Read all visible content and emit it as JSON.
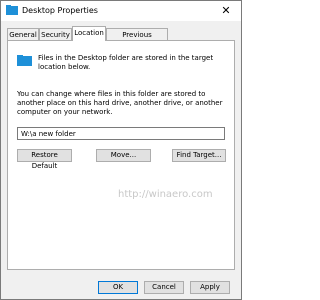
{
  "window": {
    "title": "Desktop Properties",
    "close_glyph": "✕",
    "icon": "folder-icon"
  },
  "tabs": [
    {
      "label": "General"
    },
    {
      "label": "Security"
    },
    {
      "label": "Location",
      "active": true
    },
    {
      "label": "Previous Versions"
    }
  ],
  "location": {
    "info_text": "Files in the Desktop folder are stored in the target location below.",
    "description": "You can change where files in this folder are stored to another place on this hard drive, another drive, or another computer on your network.",
    "path_value": "W:\\a new folder",
    "buttons": {
      "restore_default": "Restore Default",
      "move": "Move...",
      "find_target": "Find Target..."
    },
    "watermark": "http://winaero.com"
  },
  "dialog_buttons": {
    "ok": "OK",
    "cancel": "Cancel",
    "apply": "Apply"
  },
  "colors": {
    "folder_blue": "#1e90d8",
    "primary_border": "#0078d7"
  }
}
